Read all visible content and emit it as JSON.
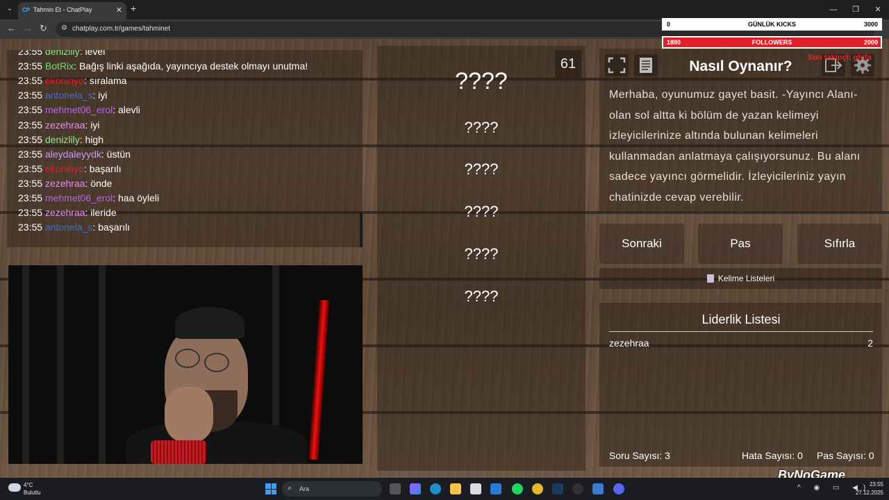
{
  "browser": {
    "tab_title": "Tahmin Et - ChatPlay",
    "favicon_text": "CP",
    "url": "chatplay.com.tr/games/tahminet",
    "win_minimize": "—",
    "win_restore": "❐",
    "win_close": "✕"
  },
  "chat": {
    "messages": [
      {
        "time": "23:55",
        "user": "denizlily",
        "color": "#8fe38f",
        "text": "level"
      },
      {
        "time": "23:55",
        "user": "BotRix",
        "color": "#6ee06e",
        "text": "Bağış linki aşağıda, yayıncıya destek olmayı unutma!"
      },
      {
        "time": "23:55",
        "user": "ekoninyo",
        "color": "#e0202a",
        "text": "sıralama"
      },
      {
        "time": "23:55",
        "user": "antonela_s",
        "color": "#3f6ec7",
        "text": "iyi"
      },
      {
        "time": "23:55",
        "user": "mehmet06_erol",
        "color": "#b763e8",
        "text": "alevli"
      },
      {
        "time": "23:55",
        "user": "zezehraa",
        "color": "#e58ff0",
        "text": "iyi"
      },
      {
        "time": "23:55",
        "user": "denizlily",
        "color": "#8fe38f",
        "text": "high"
      },
      {
        "time": "23:55",
        "user": "aleydaleyydk",
        "color": "#c79cf5",
        "text": "üstün"
      },
      {
        "time": "23:55",
        "user": "ekoninyo",
        "color": "#e0202a",
        "text": "başarılı"
      },
      {
        "time": "23:55",
        "user": "zezehraa",
        "color": "#e58ff0",
        "text": "önde"
      },
      {
        "time": "23:55",
        "user": "mehmet06_erol",
        "color": "#b763e8",
        "text": "haa öyleli"
      },
      {
        "time": "23:55",
        "user": "zezehraa",
        "color": "#e58ff0",
        "text": "ileride"
      },
      {
        "time": "23:55",
        "user": "antonela_s",
        "color": "#3f6ec7",
        "text": "başarılı"
      }
    ]
  },
  "game": {
    "timer": "61",
    "main_word": "????",
    "hidden_words": [
      "????",
      "????",
      "????",
      "????",
      "????"
    ]
  },
  "howto": {
    "title": "Nasıl Oynanır?",
    "text": "Merhaba, oyunumuz gayet basit. -Yayıncı Alanı- olan sol altta ki bölüm de yazan kelimeyi izleyicilerinize altında bulunan kelimeleri kullanmadan anlatmaya çalışıyorsunuz. Bu alanı sadece yayıncı görmelidir. İzleyicileriniz yayın chatinizde cevap verebilir."
  },
  "controls": {
    "next_label": "Sonraki",
    "pass_label": "Pas",
    "reset_label": "Sıfırla",
    "word_lists_label": "Kelime Listeleri"
  },
  "leaderboard": {
    "title": "Liderlik Listesi",
    "rows": [
      {
        "name": "zezehraa",
        "score": "2"
      }
    ],
    "question_count": "Soru Sayısı: 3",
    "error_count": "Hata Sayısı: 0",
    "pass_count": "Pas Sayısı: 0"
  },
  "overlays": {
    "kicks_current": "0",
    "kicks_label": "GÜNLÜK KICKS",
    "kicks_goal": "3000",
    "kicks_progress": 0,
    "followers_current": "1880",
    "followers_label": "FOLLOWERS",
    "followers_goal": "2000",
    "followers_progress": 0.94,
    "red_text": "Son takipçi: ghifa",
    "brand": "ByNoGame"
  },
  "taskbar": {
    "weather_temp": "4°C",
    "weather_desc": "Bulutlu",
    "search_placeholder": "Ara",
    "time": "23:55",
    "date": "27.12.2025"
  },
  "colors": {
    "accent_red": "#e0212b",
    "wood_base": "#5f4a39"
  }
}
